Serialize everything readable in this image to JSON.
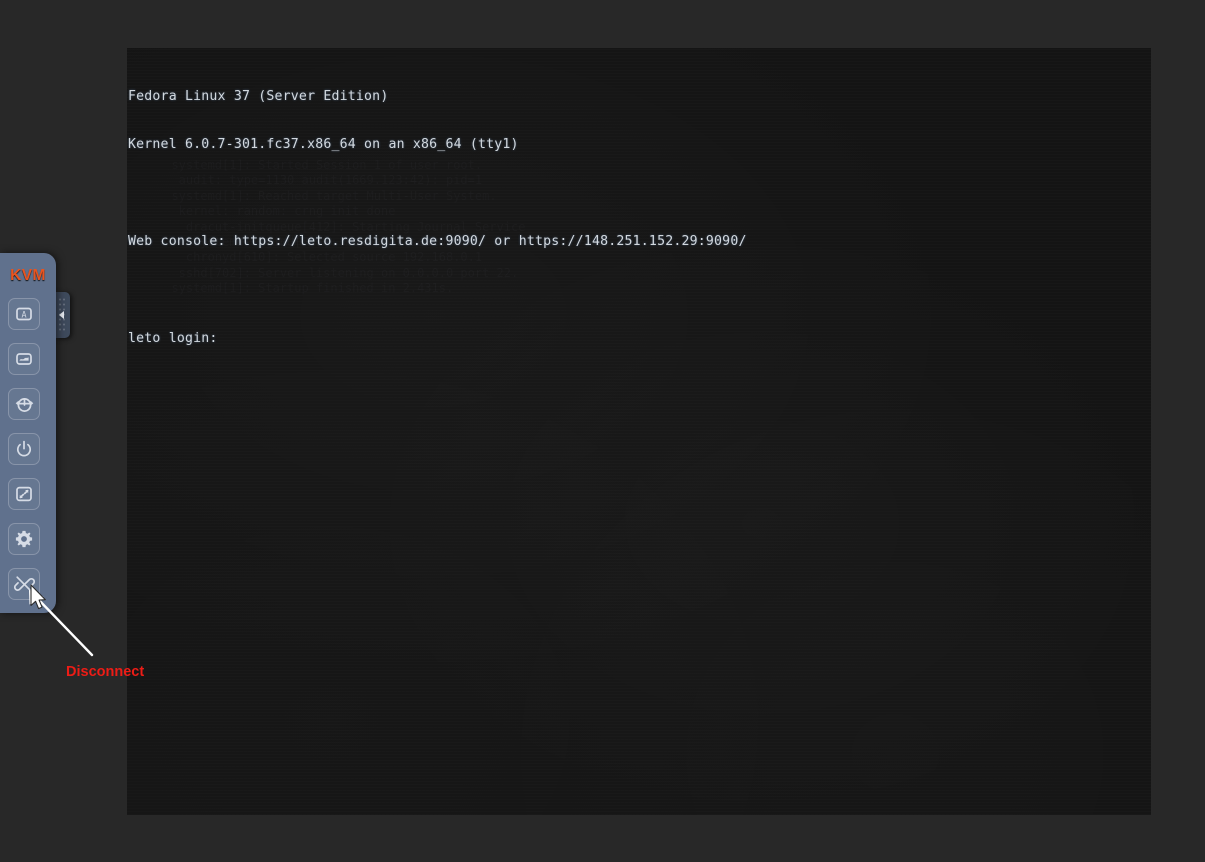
{
  "page": {
    "background_color": "#282828"
  },
  "console": {
    "background_color": "#141414",
    "text_color": "#d2d8de",
    "lines": [
      "Fedora Linux 37 (Server Edition)",
      "Kernel 6.0.7-301.fc37.x86_64 on an x86_64 (tty1)",
      "",
      "Web console: https://leto.resdigita.de:9090/ or https://148.251.152.29:9090/",
      "",
      "leto login:"
    ],
    "distro": "Fedora Linux 37 (Server Edition)",
    "kernel": "Kernel 6.0.7-301.fc37.x86_64 on an x86_64 (tty1)",
    "web_console": "Web console: https://leto.resdigita.de:9090/ or https://148.251.152.29:9090/",
    "login_prompt": "leto login:",
    "hostname": "leto",
    "tty": "tty1",
    "ghost_text": "  systemd[1]: Started Session 1 of user root.\n   audit: type=1130 audit(1669.123:42): pid=1\n  systemd[1]: Reached target Multi-User System.\n   kernel: random: crng init done\n    dracut-initqueue[412]: Starting Journal Service\n     systemd-logind[589]: New seat seat0.\n    chronyd[610]: Selected source 192.168.0.1\n   sshd[702]: Server listening on 0.0.0.0 port 22.\n  systemd[1]: Startup finished in 2.431s."
  },
  "toolbar": {
    "title": "KVM",
    "title_color": "#e8541f",
    "panel_color": "#60718d",
    "buttons": [
      {
        "name": "keyboard-button",
        "icon": "keyboard-icon",
        "label": "Keyboard"
      },
      {
        "name": "mouse-button",
        "icon": "mouse-icon",
        "label": "Mouse"
      },
      {
        "name": "reset-button",
        "icon": "reset-icon",
        "label": "Reset"
      },
      {
        "name": "power-button",
        "icon": "power-icon",
        "label": "Power"
      },
      {
        "name": "fit-screen-button",
        "icon": "fit-screen-icon",
        "label": "Fit to screen"
      },
      {
        "name": "settings-button",
        "icon": "gear-icon",
        "label": "Settings"
      },
      {
        "name": "disconnect-button",
        "icon": "broken-link-icon",
        "label": "Disconnect"
      }
    ],
    "handle": {
      "name": "collapse-handle",
      "icon": "chevron-left-icon"
    }
  },
  "annotation": {
    "label": "Disconnect",
    "color": "#ed1c16",
    "points_to": "disconnect-button"
  }
}
